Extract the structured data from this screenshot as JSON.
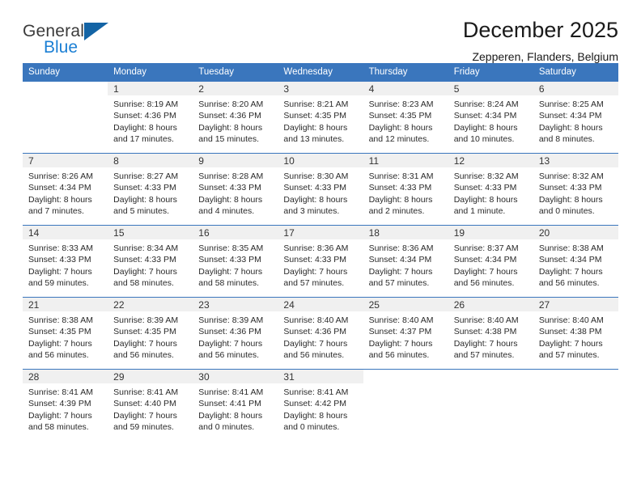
{
  "brand": {
    "line1": "General",
    "line2": "Blue",
    "logo_icon": "blue-triangle-logo",
    "accent_color": "#1b7fd4",
    "triangle_color": "#1464a5"
  },
  "header": {
    "title": "December 2025",
    "location": "Zepperen, Flanders, Belgium"
  },
  "colors": {
    "header_bar": "#3a76bd",
    "daynum_bg": "#f0f0f0",
    "cell_bg": "#ffffff",
    "text": "#222222"
  },
  "weekdays": [
    "Sunday",
    "Monday",
    "Tuesday",
    "Wednesday",
    "Thursday",
    "Friday",
    "Saturday"
  ],
  "weeks": [
    [
      {
        "day": "",
        "sunrise": "",
        "sunset": "",
        "daylight1": "",
        "daylight2": "",
        "blank": true
      },
      {
        "day": "1",
        "sunrise": "Sunrise: 8:19 AM",
        "sunset": "Sunset: 4:36 PM",
        "daylight1": "Daylight: 8 hours",
        "daylight2": "and 17 minutes."
      },
      {
        "day": "2",
        "sunrise": "Sunrise: 8:20 AM",
        "sunset": "Sunset: 4:36 PM",
        "daylight1": "Daylight: 8 hours",
        "daylight2": "and 15 minutes."
      },
      {
        "day": "3",
        "sunrise": "Sunrise: 8:21 AM",
        "sunset": "Sunset: 4:35 PM",
        "daylight1": "Daylight: 8 hours",
        "daylight2": "and 13 minutes."
      },
      {
        "day": "4",
        "sunrise": "Sunrise: 8:23 AM",
        "sunset": "Sunset: 4:35 PM",
        "daylight1": "Daylight: 8 hours",
        "daylight2": "and 12 minutes."
      },
      {
        "day": "5",
        "sunrise": "Sunrise: 8:24 AM",
        "sunset": "Sunset: 4:34 PM",
        "daylight1": "Daylight: 8 hours",
        "daylight2": "and 10 minutes."
      },
      {
        "day": "6",
        "sunrise": "Sunrise: 8:25 AM",
        "sunset": "Sunset: 4:34 PM",
        "daylight1": "Daylight: 8 hours",
        "daylight2": "and 8 minutes."
      }
    ],
    [
      {
        "day": "7",
        "sunrise": "Sunrise: 8:26 AM",
        "sunset": "Sunset: 4:34 PM",
        "daylight1": "Daylight: 8 hours",
        "daylight2": "and 7 minutes."
      },
      {
        "day": "8",
        "sunrise": "Sunrise: 8:27 AM",
        "sunset": "Sunset: 4:33 PM",
        "daylight1": "Daylight: 8 hours",
        "daylight2": "and 5 minutes."
      },
      {
        "day": "9",
        "sunrise": "Sunrise: 8:28 AM",
        "sunset": "Sunset: 4:33 PM",
        "daylight1": "Daylight: 8 hours",
        "daylight2": "and 4 minutes."
      },
      {
        "day": "10",
        "sunrise": "Sunrise: 8:30 AM",
        "sunset": "Sunset: 4:33 PM",
        "daylight1": "Daylight: 8 hours",
        "daylight2": "and 3 minutes."
      },
      {
        "day": "11",
        "sunrise": "Sunrise: 8:31 AM",
        "sunset": "Sunset: 4:33 PM",
        "daylight1": "Daylight: 8 hours",
        "daylight2": "and 2 minutes."
      },
      {
        "day": "12",
        "sunrise": "Sunrise: 8:32 AM",
        "sunset": "Sunset: 4:33 PM",
        "daylight1": "Daylight: 8 hours",
        "daylight2": "and 1 minute."
      },
      {
        "day": "13",
        "sunrise": "Sunrise: 8:32 AM",
        "sunset": "Sunset: 4:33 PM",
        "daylight1": "Daylight: 8 hours",
        "daylight2": "and 0 minutes."
      }
    ],
    [
      {
        "day": "14",
        "sunrise": "Sunrise: 8:33 AM",
        "sunset": "Sunset: 4:33 PM",
        "daylight1": "Daylight: 7 hours",
        "daylight2": "and 59 minutes."
      },
      {
        "day": "15",
        "sunrise": "Sunrise: 8:34 AM",
        "sunset": "Sunset: 4:33 PM",
        "daylight1": "Daylight: 7 hours",
        "daylight2": "and 58 minutes."
      },
      {
        "day": "16",
        "sunrise": "Sunrise: 8:35 AM",
        "sunset": "Sunset: 4:33 PM",
        "daylight1": "Daylight: 7 hours",
        "daylight2": "and 58 minutes."
      },
      {
        "day": "17",
        "sunrise": "Sunrise: 8:36 AM",
        "sunset": "Sunset: 4:33 PM",
        "daylight1": "Daylight: 7 hours",
        "daylight2": "and 57 minutes."
      },
      {
        "day": "18",
        "sunrise": "Sunrise: 8:36 AM",
        "sunset": "Sunset: 4:34 PM",
        "daylight1": "Daylight: 7 hours",
        "daylight2": "and 57 minutes."
      },
      {
        "day": "19",
        "sunrise": "Sunrise: 8:37 AM",
        "sunset": "Sunset: 4:34 PM",
        "daylight1": "Daylight: 7 hours",
        "daylight2": "and 56 minutes."
      },
      {
        "day": "20",
        "sunrise": "Sunrise: 8:38 AM",
        "sunset": "Sunset: 4:34 PM",
        "daylight1": "Daylight: 7 hours",
        "daylight2": "and 56 minutes."
      }
    ],
    [
      {
        "day": "21",
        "sunrise": "Sunrise: 8:38 AM",
        "sunset": "Sunset: 4:35 PM",
        "daylight1": "Daylight: 7 hours",
        "daylight2": "and 56 minutes."
      },
      {
        "day": "22",
        "sunrise": "Sunrise: 8:39 AM",
        "sunset": "Sunset: 4:35 PM",
        "daylight1": "Daylight: 7 hours",
        "daylight2": "and 56 minutes."
      },
      {
        "day": "23",
        "sunrise": "Sunrise: 8:39 AM",
        "sunset": "Sunset: 4:36 PM",
        "daylight1": "Daylight: 7 hours",
        "daylight2": "and 56 minutes."
      },
      {
        "day": "24",
        "sunrise": "Sunrise: 8:40 AM",
        "sunset": "Sunset: 4:36 PM",
        "daylight1": "Daylight: 7 hours",
        "daylight2": "and 56 minutes."
      },
      {
        "day": "25",
        "sunrise": "Sunrise: 8:40 AM",
        "sunset": "Sunset: 4:37 PM",
        "daylight1": "Daylight: 7 hours",
        "daylight2": "and 56 minutes."
      },
      {
        "day": "26",
        "sunrise": "Sunrise: 8:40 AM",
        "sunset": "Sunset: 4:38 PM",
        "daylight1": "Daylight: 7 hours",
        "daylight2": "and 57 minutes."
      },
      {
        "day": "27",
        "sunrise": "Sunrise: 8:40 AM",
        "sunset": "Sunset: 4:38 PM",
        "daylight1": "Daylight: 7 hours",
        "daylight2": "and 57 minutes."
      }
    ],
    [
      {
        "day": "28",
        "sunrise": "Sunrise: 8:41 AM",
        "sunset": "Sunset: 4:39 PM",
        "daylight1": "Daylight: 7 hours",
        "daylight2": "and 58 minutes."
      },
      {
        "day": "29",
        "sunrise": "Sunrise: 8:41 AM",
        "sunset": "Sunset: 4:40 PM",
        "daylight1": "Daylight: 7 hours",
        "daylight2": "and 59 minutes."
      },
      {
        "day": "30",
        "sunrise": "Sunrise: 8:41 AM",
        "sunset": "Sunset: 4:41 PM",
        "daylight1": "Daylight: 8 hours",
        "daylight2": "and 0 minutes."
      },
      {
        "day": "31",
        "sunrise": "Sunrise: 8:41 AM",
        "sunset": "Sunset: 4:42 PM",
        "daylight1": "Daylight: 8 hours",
        "daylight2": "and 0 minutes."
      },
      {
        "day": "",
        "sunrise": "",
        "sunset": "",
        "daylight1": "",
        "daylight2": "",
        "blank": true
      },
      {
        "day": "",
        "sunrise": "",
        "sunset": "",
        "daylight1": "",
        "daylight2": "",
        "blank": true
      },
      {
        "day": "",
        "sunrise": "",
        "sunset": "",
        "daylight1": "",
        "daylight2": "",
        "blank": true
      }
    ]
  ]
}
